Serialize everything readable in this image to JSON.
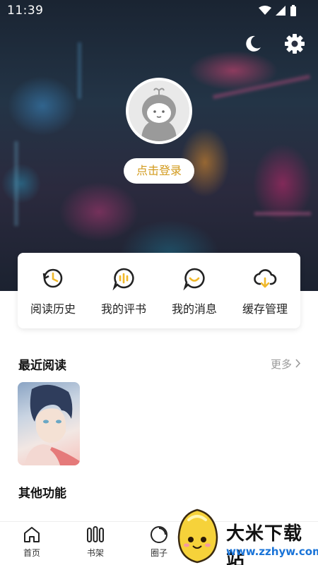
{
  "status_bar": {
    "time": "11:39"
  },
  "header": {
    "login_label": "点击登录",
    "icons": [
      "moon-icon",
      "settings-gear-icon"
    ]
  },
  "functions": [
    {
      "label": "阅读历史",
      "icon": "history-clock-icon"
    },
    {
      "label": "我的评书",
      "icon": "comment-bubble-icon"
    },
    {
      "label": "我的消息",
      "icon": "message-bubble-icon"
    },
    {
      "label": "缓存管理",
      "icon": "cloud-download-icon"
    }
  ],
  "recent": {
    "title": "最近阅读",
    "more_label": "更多"
  },
  "other": {
    "title": "其他功能"
  },
  "tabbar": [
    {
      "label": "首页",
      "icon": "home-icon"
    },
    {
      "label": "书架",
      "icon": "bookshelf-icon"
    },
    {
      "label": "圈子",
      "icon": "circle-icon"
    }
  ],
  "watermark": {
    "name": "大米下载站",
    "url": "www.zzhyw.com"
  },
  "colors": {
    "accent": "#d29a1c",
    "icon": "#222222",
    "icon_accent": "#f0b82a"
  }
}
